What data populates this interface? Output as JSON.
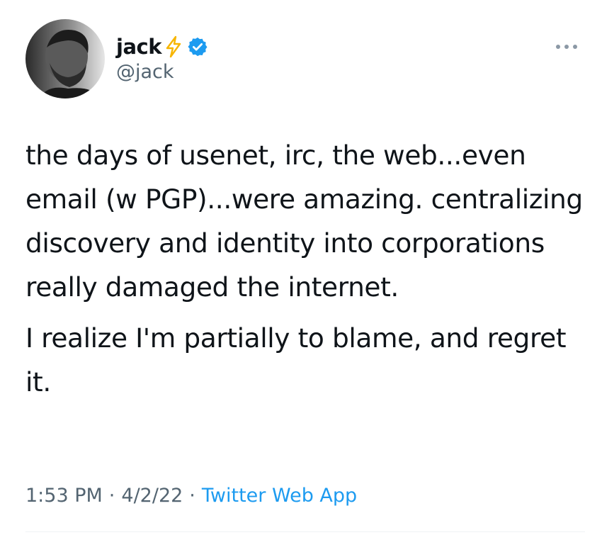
{
  "author": {
    "display_name": "jack",
    "handle": "@jack",
    "verified": true
  },
  "icons": {
    "avatar": "profile-photo",
    "bolt": "lightning-bolt-icon",
    "verified": "verified-badge-icon",
    "more": "more-options-icon"
  },
  "tweet": {
    "paragraphs": [
      "the days of usenet, irc, the web...even email (w PGP)...were amazing. centralizing discovery and identity into corporations really damaged the internet.",
      "I realize I'm partially to blame, and regret it."
    ]
  },
  "meta": {
    "time": "1:53 PM",
    "separator": "·",
    "date": "4/2/22",
    "source": "Twitter Web App"
  },
  "colors": {
    "text": "#0f1419",
    "secondary": "#536471",
    "accent": "#1d9bf0",
    "bolt": "#f7b500"
  }
}
